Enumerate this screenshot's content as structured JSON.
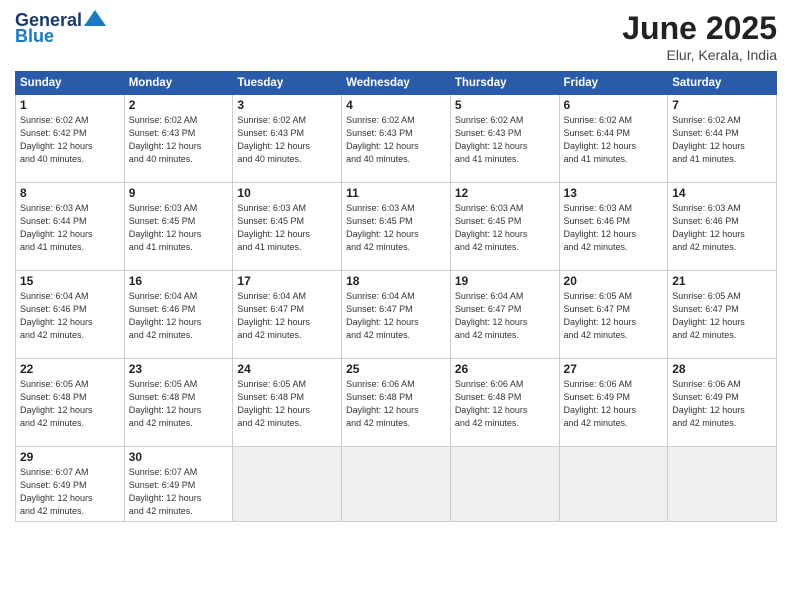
{
  "logo": {
    "line1": "General",
    "line2": "Blue"
  },
  "title": "June 2025",
  "location": "Elur, Kerala, India",
  "headers": [
    "Sunday",
    "Monday",
    "Tuesday",
    "Wednesday",
    "Thursday",
    "Friday",
    "Saturday"
  ],
  "weeks": [
    [
      {
        "day": "1",
        "info": "Sunrise: 6:02 AM\nSunset: 6:42 PM\nDaylight: 12 hours\nand 40 minutes."
      },
      {
        "day": "2",
        "info": "Sunrise: 6:02 AM\nSunset: 6:43 PM\nDaylight: 12 hours\nand 40 minutes."
      },
      {
        "day": "3",
        "info": "Sunrise: 6:02 AM\nSunset: 6:43 PM\nDaylight: 12 hours\nand 40 minutes."
      },
      {
        "day": "4",
        "info": "Sunrise: 6:02 AM\nSunset: 6:43 PM\nDaylight: 12 hours\nand 40 minutes."
      },
      {
        "day": "5",
        "info": "Sunrise: 6:02 AM\nSunset: 6:43 PM\nDaylight: 12 hours\nand 41 minutes."
      },
      {
        "day": "6",
        "info": "Sunrise: 6:02 AM\nSunset: 6:44 PM\nDaylight: 12 hours\nand 41 minutes."
      },
      {
        "day": "7",
        "info": "Sunrise: 6:02 AM\nSunset: 6:44 PM\nDaylight: 12 hours\nand 41 minutes."
      }
    ],
    [
      {
        "day": "8",
        "info": "Sunrise: 6:03 AM\nSunset: 6:44 PM\nDaylight: 12 hours\nand 41 minutes."
      },
      {
        "day": "9",
        "info": "Sunrise: 6:03 AM\nSunset: 6:45 PM\nDaylight: 12 hours\nand 41 minutes."
      },
      {
        "day": "10",
        "info": "Sunrise: 6:03 AM\nSunset: 6:45 PM\nDaylight: 12 hours\nand 41 minutes."
      },
      {
        "day": "11",
        "info": "Sunrise: 6:03 AM\nSunset: 6:45 PM\nDaylight: 12 hours\nand 42 minutes."
      },
      {
        "day": "12",
        "info": "Sunrise: 6:03 AM\nSunset: 6:45 PM\nDaylight: 12 hours\nand 42 minutes."
      },
      {
        "day": "13",
        "info": "Sunrise: 6:03 AM\nSunset: 6:46 PM\nDaylight: 12 hours\nand 42 minutes."
      },
      {
        "day": "14",
        "info": "Sunrise: 6:03 AM\nSunset: 6:46 PM\nDaylight: 12 hours\nand 42 minutes."
      }
    ],
    [
      {
        "day": "15",
        "info": "Sunrise: 6:04 AM\nSunset: 6:46 PM\nDaylight: 12 hours\nand 42 minutes."
      },
      {
        "day": "16",
        "info": "Sunrise: 6:04 AM\nSunset: 6:46 PM\nDaylight: 12 hours\nand 42 minutes."
      },
      {
        "day": "17",
        "info": "Sunrise: 6:04 AM\nSunset: 6:47 PM\nDaylight: 12 hours\nand 42 minutes."
      },
      {
        "day": "18",
        "info": "Sunrise: 6:04 AM\nSunset: 6:47 PM\nDaylight: 12 hours\nand 42 minutes."
      },
      {
        "day": "19",
        "info": "Sunrise: 6:04 AM\nSunset: 6:47 PM\nDaylight: 12 hours\nand 42 minutes."
      },
      {
        "day": "20",
        "info": "Sunrise: 6:05 AM\nSunset: 6:47 PM\nDaylight: 12 hours\nand 42 minutes."
      },
      {
        "day": "21",
        "info": "Sunrise: 6:05 AM\nSunset: 6:47 PM\nDaylight: 12 hours\nand 42 minutes."
      }
    ],
    [
      {
        "day": "22",
        "info": "Sunrise: 6:05 AM\nSunset: 6:48 PM\nDaylight: 12 hours\nand 42 minutes."
      },
      {
        "day": "23",
        "info": "Sunrise: 6:05 AM\nSunset: 6:48 PM\nDaylight: 12 hours\nand 42 minutes."
      },
      {
        "day": "24",
        "info": "Sunrise: 6:05 AM\nSunset: 6:48 PM\nDaylight: 12 hours\nand 42 minutes."
      },
      {
        "day": "25",
        "info": "Sunrise: 6:06 AM\nSunset: 6:48 PM\nDaylight: 12 hours\nand 42 minutes."
      },
      {
        "day": "26",
        "info": "Sunrise: 6:06 AM\nSunset: 6:48 PM\nDaylight: 12 hours\nand 42 minutes."
      },
      {
        "day": "27",
        "info": "Sunrise: 6:06 AM\nSunset: 6:49 PM\nDaylight: 12 hours\nand 42 minutes."
      },
      {
        "day": "28",
        "info": "Sunrise: 6:06 AM\nSunset: 6:49 PM\nDaylight: 12 hours\nand 42 minutes."
      }
    ],
    [
      {
        "day": "29",
        "info": "Sunrise: 6:07 AM\nSunset: 6:49 PM\nDaylight: 12 hours\nand 42 minutes."
      },
      {
        "day": "30",
        "info": "Sunrise: 6:07 AM\nSunset: 6:49 PM\nDaylight: 12 hours\nand 42 minutes."
      },
      {
        "day": "",
        "info": ""
      },
      {
        "day": "",
        "info": ""
      },
      {
        "day": "",
        "info": ""
      },
      {
        "day": "",
        "info": ""
      },
      {
        "day": "",
        "info": ""
      }
    ]
  ]
}
